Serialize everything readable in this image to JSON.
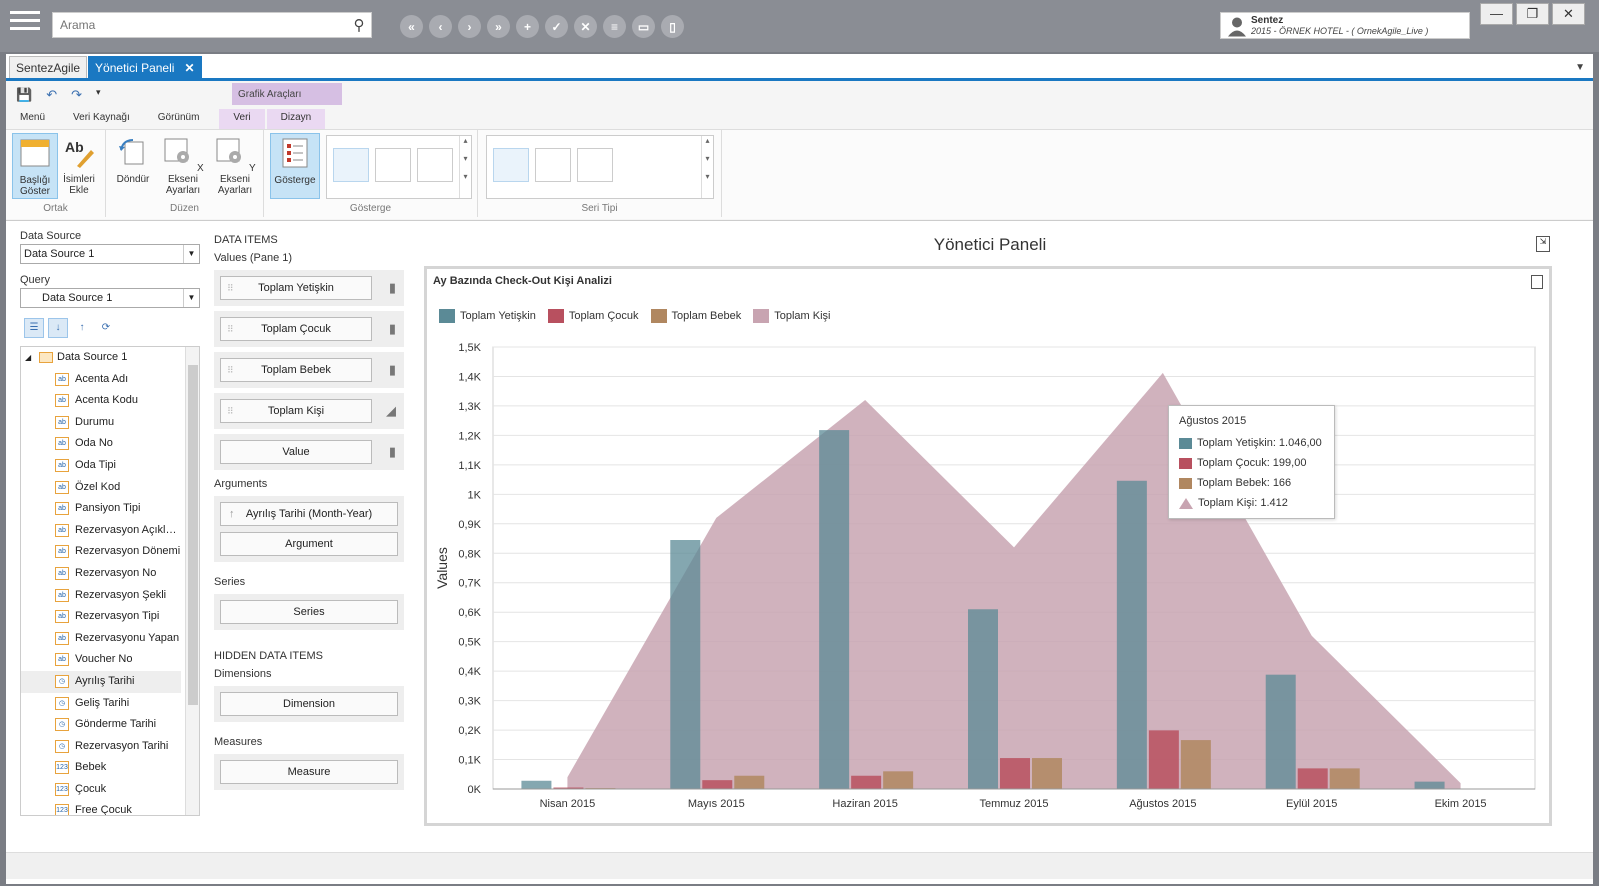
{
  "topbar": {
    "search_placeholder": "Arama",
    "nav_buttons": [
      "first-icon",
      "prev-icon",
      "next-icon",
      "last-icon",
      "add-icon",
      "check-icon",
      "close-icon",
      "list-icon",
      "keyboard-icon",
      "trash-icon"
    ],
    "nav_glyphs": [
      "«",
      "‹",
      "›",
      "»",
      "+",
      "✓",
      "✕",
      "≡",
      "▭",
      "▯"
    ],
    "user_name": "Sentez",
    "company": "2015 - ÖRNEK HOTEL - ( OrnekAgile_Live )",
    "win_buttons": [
      "—",
      "❐",
      "✕"
    ]
  },
  "tabs": [
    {
      "label": "SentezAgile"
    },
    {
      "label": "Yönetici Paneli",
      "close": "✕"
    }
  ],
  "ribbon": {
    "context_group": "Grafik Araçları",
    "tabs": [
      "Menü",
      "Veri Kaynağı",
      "Görünüm",
      "Veri",
      "Dizayn"
    ],
    "groups": {
      "ortak": "Ortak",
      "duzen": "Düzen",
      "gosterge": "Gösterge",
      "seri_tipi": "Seri Tipi"
    },
    "buttons": {
      "baslik": "Başlığı Göster",
      "isimler": "İsimleri Ekle",
      "dondur": "Döndür",
      "x_ekseni": "X Ekseni Ayarları",
      "y_ekseni": "Y Ekseni Ayarları",
      "gosterge": "Gösterge"
    }
  },
  "left": {
    "ds_label": "Data Source",
    "ds_value": "Data Source 1",
    "query_label": "Query",
    "query_value": "Data Source 1",
    "tree_root": "Data Source 1",
    "tree_items": [
      {
        "label": "Acenta Adı",
        "type": "ab"
      },
      {
        "label": "Acenta Kodu",
        "type": "ab"
      },
      {
        "label": "Durumu",
        "type": "ab"
      },
      {
        "label": "Oda No",
        "type": "ab"
      },
      {
        "label": "Oda Tipi",
        "type": "ab"
      },
      {
        "label": "Özel Kod",
        "type": "ab"
      },
      {
        "label": "Pansiyon Tipi",
        "type": "ab"
      },
      {
        "label": "Rezervasyon Açıklaması",
        "type": "ab"
      },
      {
        "label": "Rezervasyon Dönemi",
        "type": "ab"
      },
      {
        "label": "Rezervasyon No",
        "type": "ab"
      },
      {
        "label": "Rezervasyon Şekli",
        "type": "ab"
      },
      {
        "label": "Rezervasyon Tipi",
        "type": "ab"
      },
      {
        "label": "Rezervasyonu Yapan",
        "type": "ab"
      },
      {
        "label": "Voucher No",
        "type": "ab"
      },
      {
        "label": "Ayrılış Tarihi",
        "type": "date"
      },
      {
        "label": "Geliş Tarihi",
        "type": "date"
      },
      {
        "label": "Gönderme Tarihi",
        "type": "date"
      },
      {
        "label": "Rezervasyon Tarihi",
        "type": "date"
      },
      {
        "label": "Bebek",
        "type": "num"
      },
      {
        "label": "Çocuk",
        "type": "num"
      },
      {
        "label": "Free Çocuk",
        "type": "num"
      }
    ]
  },
  "middle": {
    "data_items": "DATA ITEMS",
    "values_pane": "Values (Pane 1)",
    "values": [
      "Toplam Yetişkin",
      "Toplam Çocuk",
      "Toplam Bebek",
      "Toplam Kişi",
      "Value"
    ],
    "arguments": "Arguments",
    "arg_items": [
      "Ayrılış Tarihi (Month-Year)",
      "Argument"
    ],
    "series": "Series",
    "series_item": "Series",
    "hidden": "HIDDEN DATA ITEMS",
    "dimensions": "Dimensions",
    "dimension_item": "Dimension",
    "measures": "Measures",
    "measure_item": "Measure"
  },
  "dashboard": {
    "title": "Yönetici Paneli",
    "chart_title": "Ay Bazında Check-Out Kişi Analizi"
  },
  "chart_data": {
    "type": "bar",
    "title": "Ay Bazında Check-Out Kişi Analizi",
    "ylabel": "Values",
    "xlabel": "",
    "categories": [
      "Nisan 2015",
      "Mayıs 2015",
      "Haziran 2015",
      "Temmuz 2015",
      "Ağustos 2015",
      "Eylül 2015",
      "Ekim 2015"
    ],
    "yticks": [
      "0K",
      "0,1K",
      "0,2K",
      "0,3K",
      "0,4K",
      "0,5K",
      "0,6K",
      "0,7K",
      "0,8K",
      "0,9K",
      "1K",
      "1,1K",
      "1,2K",
      "1,3K",
      "1,4K",
      "1,5K"
    ],
    "ylim": [
      0,
      1500
    ],
    "legend_position": "top-left",
    "series": [
      {
        "name": "Toplam Yetişkin",
        "kind": "bar",
        "color": "#5b8a96",
        "values": [
          28,
          845,
          1218,
          610,
          1046,
          388,
          25
        ]
      },
      {
        "name": "Toplam Çocuk",
        "kind": "bar",
        "color": "#b8505f",
        "values": [
          5,
          30,
          45,
          105,
          199,
          70,
          0
        ]
      },
      {
        "name": "Toplam Bebek",
        "kind": "bar",
        "color": "#b08760",
        "values": [
          3,
          45,
          60,
          105,
          166,
          70,
          0
        ]
      },
      {
        "name": "Toplam Kişi",
        "kind": "area",
        "color": "#c8a4b1",
        "values": [
          40,
          920,
          1320,
          820,
          1412,
          520,
          20
        ]
      }
    ]
  },
  "tooltip": {
    "title": "Ağustos 2015",
    "lines": [
      "Toplam Yetişkin: 1.046,00",
      "Toplam Çocuk: 199,00",
      "Toplam Bebek: 166",
      "Toplam Kişi: 1.412"
    ]
  }
}
